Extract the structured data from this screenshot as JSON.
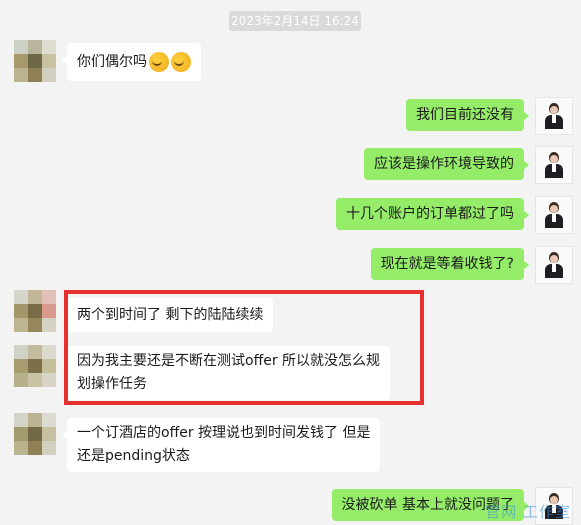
{
  "timestamp": "2023年2月14日 16:24",
  "messages": [
    {
      "side": "in",
      "text": "你们偶尔吗",
      "emojis": [
        "tears-of-joy-emoji",
        "tears-of-joy-emoji"
      ]
    },
    {
      "side": "out",
      "text": "我们目前还没有"
    },
    {
      "side": "out",
      "text": "应该是操作环境导致的"
    },
    {
      "side": "out",
      "text": "十几个账户的订单都过了吗"
    },
    {
      "side": "out",
      "text": "现在就是等着收钱了?"
    },
    {
      "side": "in",
      "text": "两个到时间了 剩下的陆陆续续"
    },
    {
      "side": "in",
      "lines": [
        "因为我主要还是不断在测试offer 所以就没怎么规",
        "划操作任务"
      ]
    },
    {
      "side": "in",
      "lines": [
        "一个订酒店的offer 按理说也到时间发钱了 但是",
        "还是pending状态"
      ]
    },
    {
      "side": "out",
      "text": "没被砍单 基本上就没问题了"
    }
  ],
  "watermark": "官网 工作室",
  "colors": {
    "background": "#f3f3f3",
    "outgoing_bubble": "#95ec69",
    "incoming_bubble": "#ffffff",
    "highlight_border": "#e8302f"
  }
}
